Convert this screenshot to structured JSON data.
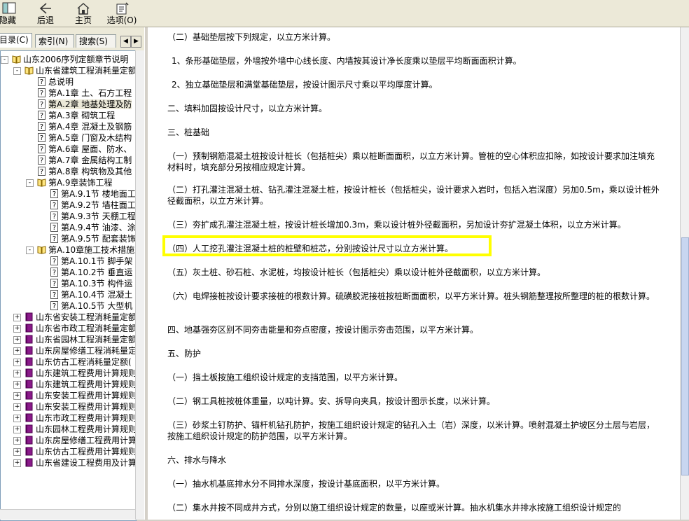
{
  "toolbar": {
    "hide_label": "隐藏",
    "back_label": "后退",
    "home_label": "主页",
    "options_label": "选项(O)"
  },
  "tabs": {
    "contents": "目录(C)",
    "index": "索引(N)",
    "search": "搜索(S)",
    "prev_arrow": "◀",
    "next_arrow": "▶"
  },
  "tree": [
    {
      "label": "山东2006序列定额章节说明",
      "icon": "open-book-icon",
      "expander": "-"
    },
    {
      "label": "山东省建筑工程消耗量定额",
      "icon": "open-book-icon",
      "expander": "-"
    },
    {
      "label": "总说明",
      "icon": "help-page-icon",
      "expander": ""
    },
    {
      "label": "第A.1章 土、石方工程",
      "icon": "help-page-icon",
      "expander": ""
    },
    {
      "label": "第A.2章 地基处理及防",
      "icon": "help-page-icon",
      "expander": "",
      "selected": true
    },
    {
      "label": "第A.3章 砌筑工程",
      "icon": "help-page-icon",
      "expander": ""
    },
    {
      "label": "第A.4章 混凝土及钢筋",
      "icon": "help-page-icon",
      "expander": ""
    },
    {
      "label": "第A.5章 门窗及木结构",
      "icon": "help-page-icon",
      "expander": ""
    },
    {
      "label": "第A.6章 屋面、防水、",
      "icon": "help-page-icon",
      "expander": ""
    },
    {
      "label": "第A.7章 金属结构工制",
      "icon": "help-page-icon",
      "expander": ""
    },
    {
      "label": "第A.8章 构筑物及其他",
      "icon": "help-page-icon",
      "expander": ""
    },
    {
      "label": "第A.9章装饰工程",
      "icon": "open-book-icon",
      "expander": "-"
    },
    {
      "label": "第A.9.1节 楼地面工",
      "icon": "help-page-icon",
      "expander": ""
    },
    {
      "label": "第A.9.2节 墙柱面工",
      "icon": "help-page-icon",
      "expander": ""
    },
    {
      "label": "第A.9.3节 天棚工程",
      "icon": "help-page-icon",
      "expander": ""
    },
    {
      "label": "第A.9.4节 油漆、涂",
      "icon": "help-page-icon",
      "expander": ""
    },
    {
      "label": "第A.9.5节 配套装饰",
      "icon": "help-page-icon",
      "expander": ""
    },
    {
      "label": "第A.10章施工技术措施",
      "icon": "open-book-icon",
      "expander": "-"
    },
    {
      "label": "第A.10.1节 脚手架",
      "icon": "help-page-icon",
      "expander": ""
    },
    {
      "label": "第A.10.2节 垂直运",
      "icon": "help-page-icon",
      "expander": ""
    },
    {
      "label": "第A.10.3节 构件运",
      "icon": "help-page-icon",
      "expander": ""
    },
    {
      "label": "第A.10.4节 混凝土",
      "icon": "help-page-icon",
      "expander": ""
    },
    {
      "label": "第A.10.5节 大型机",
      "icon": "help-page-icon",
      "expander": ""
    },
    {
      "label": "山东省安装工程消耗量定额",
      "icon": "closed-book-icon",
      "expander": "+"
    },
    {
      "label": "山东省市政工程消耗量定额",
      "icon": "closed-book-icon",
      "expander": "+"
    },
    {
      "label": "山东省园林工程消耗量定额",
      "icon": "closed-book-icon",
      "expander": "+"
    },
    {
      "label": "山东房屋修缮工程消耗量定",
      "icon": "closed-book-icon",
      "expander": "+"
    },
    {
      "label": "山东仿古工程消耗量定额(",
      "icon": "closed-book-icon",
      "expander": "+"
    },
    {
      "label": "山东建筑工程费用计算规则",
      "icon": "closed-book-icon",
      "expander": "+"
    },
    {
      "label": "山东建筑工程费用计算规则",
      "icon": "closed-book-icon",
      "expander": "+"
    },
    {
      "label": "山东安装工程费用计算规则",
      "icon": "closed-book-icon",
      "expander": "+"
    },
    {
      "label": "山东安装工程费用计算规则",
      "icon": "closed-book-icon",
      "expander": "+"
    },
    {
      "label": "山东市政工程费用计算规则",
      "icon": "closed-book-icon",
      "expander": "+"
    },
    {
      "label": "山东园林工程费用计算规则",
      "icon": "closed-book-icon",
      "expander": "+"
    },
    {
      "label": "山东房屋修缮工程费用计算",
      "icon": "closed-book-icon",
      "expander": "+"
    },
    {
      "label": "山东仿古工程费用计算规则",
      "icon": "closed-book-icon",
      "expander": "+"
    },
    {
      "label": "山东省建设工程费用及计算",
      "icon": "closed-book-icon",
      "expander": "+"
    }
  ],
  "content": [
    "（二）基础垫层按下列规定，以立方米计算。",
    "1、条形基础垫层，外墙按外墙中心线长度、内墙按其设计净长度乘以垫层平均断面面积计算。",
    "2、独立基础垫层和满堂基础垫层，按设计图示尺寸乘以平均厚度计算。",
    "二、填料加固按设计尺寸，以立方米计算。",
    "三、桩基础",
    "（一）预制钢筋混凝土桩按设计桩长（包括桩尖）乘以桩断面面积，以立方米计算。管桩的空心体积应扣除，如按设计要求加注填充材料时，填充部分另按相应规定计算。",
    "（二）打孔灌注混凝土桩、钻孔灌注混凝土桩，按设计桩长（包括桩尖，设计要求入岩时，包括入岩深度）另加0.5m，乘以设计桩外径截面积，以立方米计算。",
    "（三）夯扩成孔灌注混凝土桩，按设计桩长增加0.3m，乘以设计桩外径截面积，另加设计夯扩混凝土体积，以立方米计算。",
    "（四）人工挖孔灌注混凝土桩的桩壁和桩芯，分别按设计尺寸以立方米计算。",
    "（五）灰土桩、砂石桩、水泥桩，均按设计桩长（包括桩尖）乘以设计桩外径截面积，以立方米计算。",
    "（六）电焊接桩按设计要求接桩的根数计算。硫磺胶泥接桩按桩断面面积，以平方米计算。桩头钢筋整理按所整理的桩的根数计算。",
    "四、地基强夯区别不同夯击能量和夯点密度，按设计图示夯击范围，以平方米计算。",
    "五、防护",
    "（一）挡土板按施工组织设计规定的支挡范围，以平方米计算。",
    "（二）钢工具桩按桩体重量，以吨计算。安、拆导向夹具，按设计图示长度，以米计算。",
    "（三）砂浆土钉防护、锚杆机钻孔防护，按施工组织设计规定的钻孔入土（岩）深度，以米计算。喷射混凝土护坡区分土层与岩层，按施工组织设计规定的防护范围，以平方米计算。",
    "六、排水与降水",
    "（一）抽水机基底排水分不同排水深度，按设计基底面积，以平方米计算。",
    "（二）集水井按不同成井方式，分别以施工组织设计规定的数量，以座或米计算。抽水机集水井排水按施工组织设计规定的"
  ],
  "highlight_color": "#ffff00"
}
